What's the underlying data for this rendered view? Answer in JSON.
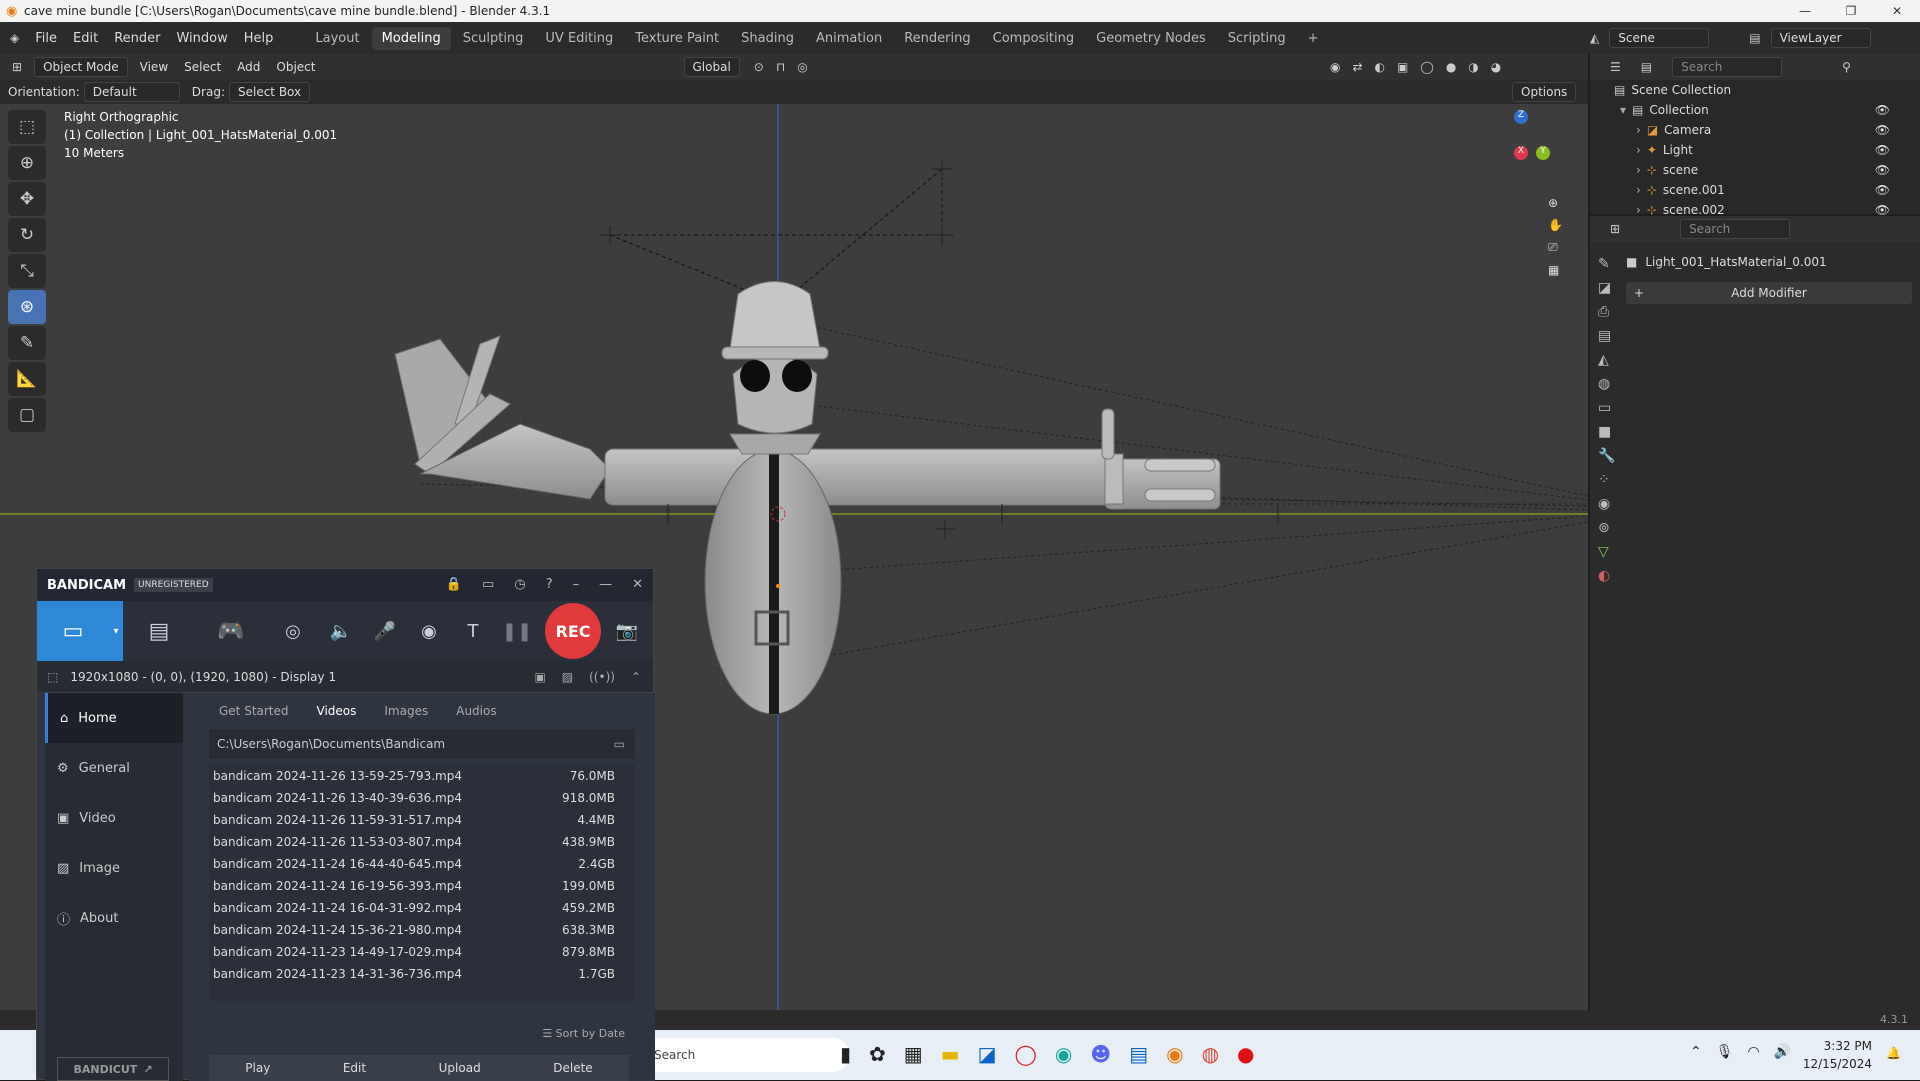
{
  "title_bar": {
    "title": "cave mine bundle [C:\\Users\\Rogan\\Documents\\cave mine bundle.blend] - Blender 4.3.1",
    "buttons": [
      "—",
      "❐",
      "✕"
    ]
  },
  "menu": {
    "items": [
      "File",
      "Edit",
      "Render",
      "Window",
      "Help"
    ],
    "workspaces": [
      "Layout",
      "Modeling",
      "Sculpting",
      "UV Editing",
      "Texture Paint",
      "Shading",
      "Animation",
      "Rendering",
      "Compositing",
      "Geometry Nodes",
      "Scripting",
      "+"
    ],
    "active_workspace": "Modeling",
    "scene_label": "Scene",
    "view_layer_label": "ViewLayer"
  },
  "viewport_header": {
    "mode": "Object Mode",
    "menus": [
      "View",
      "Select",
      "Add",
      "Object"
    ],
    "transform": "Global",
    "options_label": "Options",
    "orientation_label": "Orientation:",
    "orientation_value": "Default",
    "drag_label": "Drag:",
    "drag_value": "Select Box"
  },
  "viewport_info": {
    "view_name": "Right Orthographic",
    "collection_line": "(1) Collection | Light_001_HatsMaterial_0.001",
    "scale": "10 Meters"
  },
  "gizmo": {
    "z": "Z",
    "y": "Y",
    "x": "X"
  },
  "outliner": {
    "search_placeholder": "Search",
    "root": "Scene Collection",
    "collection": "Collection",
    "items": [
      "Camera",
      "Light",
      "scene",
      "scene.001",
      "scene.002"
    ]
  },
  "properties": {
    "search_placeholder": "Search",
    "object_name": "Light_001_HatsMaterial_0.001",
    "add_modifier": "Add Modifier"
  },
  "status_bar": {
    "version": "4.3.1"
  },
  "bandicam": {
    "brand": "BANDICAM",
    "registration": "UNREGISTERED",
    "rec_label": "REC",
    "resolution": "1920x1080 - (0, 0), (1920, 1080) - Display 1",
    "nav": [
      "Home",
      "General",
      "Video",
      "Image",
      "About"
    ],
    "tabs": [
      "Get Started",
      "Videos",
      "Images",
      "Audios"
    ],
    "active_tab": "Videos",
    "path": "C:\\Users\\Rogan\\Documents\\Bandicam",
    "files": [
      {
        "name": "bandicam 2024-11-26 13-59-25-793.mp4",
        "size": "76.0MB"
      },
      {
        "name": "bandicam 2024-11-26 13-40-39-636.mp4",
        "size": "918.0MB"
      },
      {
        "name": "bandicam 2024-11-26 11-59-31-517.mp4",
        "size": "4.4MB"
      },
      {
        "name": "bandicam 2024-11-26 11-53-03-807.mp4",
        "size": "438.9MB"
      },
      {
        "name": "bandicam 2024-11-24 16-44-40-645.mp4",
        "size": "2.4GB"
      },
      {
        "name": "bandicam 2024-11-24 16-19-56-393.mp4",
        "size": "199.0MB"
      },
      {
        "name": "bandicam 2024-11-24 16-04-31-992.mp4",
        "size": "459.2MB"
      },
      {
        "name": "bandicam 2024-11-24 15-36-21-980.mp4",
        "size": "638.3MB"
      },
      {
        "name": "bandicam 2024-11-23 14-49-17-029.mp4",
        "size": "879.8MB"
      },
      {
        "name": "bandicam 2024-11-23 14-31-36-736.mp4",
        "size": "1.7GB"
      }
    ],
    "sort_label": "Sort by Date",
    "bandicut": "BANDICUT",
    "actions": [
      "Play",
      "Edit",
      "Upload",
      "Delete"
    ]
  },
  "taskbar": {
    "search_placeholder": "Search",
    "time": "3:32 PM",
    "date": "12/15/2024"
  }
}
